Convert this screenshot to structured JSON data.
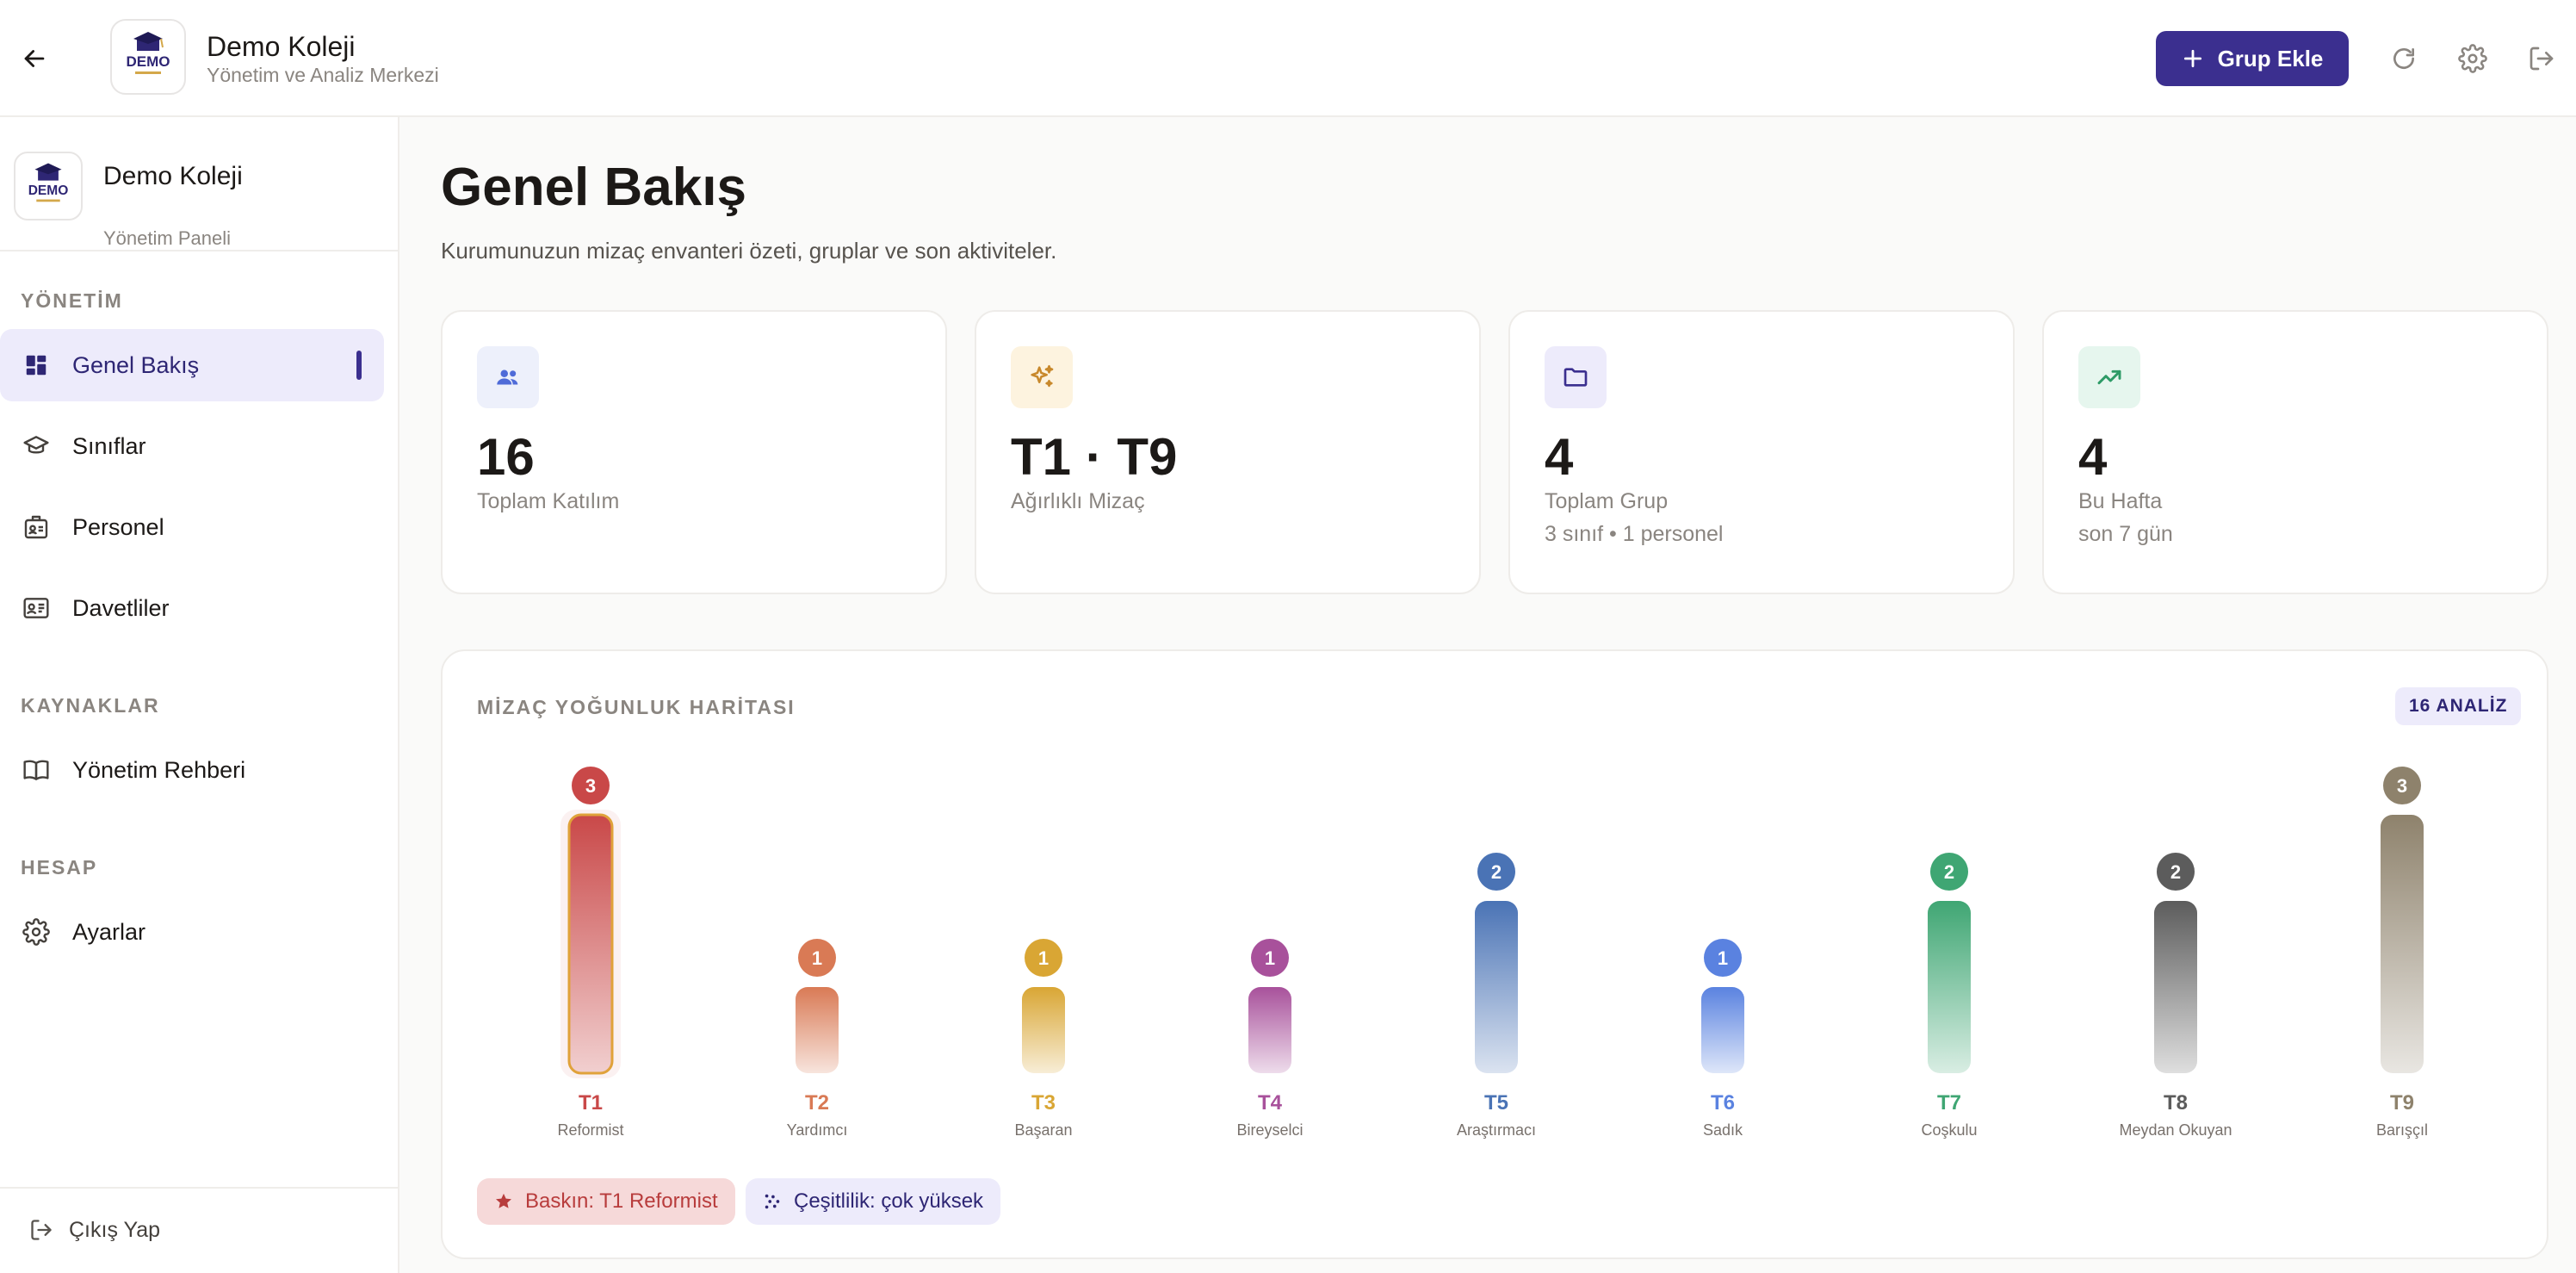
{
  "header": {
    "title": "Demo Koleji",
    "subtitle": "Yönetim ve Analiz Merkezi",
    "logo_text": "DEMO",
    "add_group_label": "Grup Ekle"
  },
  "sidebar": {
    "brand_title": "Demo Koleji",
    "brand_subtitle": "Yönetim Paneli",
    "sections": [
      {
        "label": "YÖNETİM"
      },
      {
        "label": "KAYNAKLAR"
      },
      {
        "label": "HESAP"
      }
    ],
    "items": [
      {
        "label": "Genel Bakış",
        "icon": "dashboard-icon",
        "active": true
      },
      {
        "label": "Sınıflar",
        "icon": "graduation-cap-icon"
      },
      {
        "label": "Personel",
        "icon": "id-badge-icon"
      },
      {
        "label": "Davetliler",
        "icon": "contact-card-icon"
      },
      {
        "label": "Yönetim Rehberi",
        "icon": "book-icon"
      },
      {
        "label": "Ayarlar",
        "icon": "gear-icon"
      }
    ],
    "logout_label": "Çıkış Yap"
  },
  "main": {
    "title": "Genel Bakış",
    "description": "Kurumunuzun mizaç envanteri özeti, gruplar ve son aktiviteler."
  },
  "stats": [
    {
      "value": "16",
      "label": "Toplam Katılım",
      "sub": "",
      "icon": "users-icon",
      "color": "#4f6bd8",
      "bg": "#edf0fb"
    },
    {
      "value": "T1 · T9",
      "label": "Ağırlıklı Mizaç",
      "sub": "",
      "icon": "sparkles-icon",
      "color": "#c8882b",
      "bg": "#fdf3df"
    },
    {
      "value": "4",
      "label": "Toplam Grup",
      "sub": "3 sınıf • 1 personel",
      "icon": "folder-icon",
      "color": "#3b2f8f",
      "bg": "#edebfb"
    },
    {
      "value": "4",
      "label": "Bu Hafta",
      "sub": "son 7 gün",
      "icon": "trending-up-icon",
      "color": "#2e9b67",
      "bg": "#e6f6ee"
    }
  ],
  "chart": {
    "title": "MİZAÇ YOĞUNLUK HARİTASI",
    "badge": "16 ANALİZ",
    "dominant_label": "Baskın: T1 Reformist",
    "diversity_label": "Çeşitlilik: çok yüksek"
  },
  "chart_data": {
    "type": "bar",
    "categories": [
      "T1",
      "T2",
      "T3",
      "T4",
      "T5",
      "T6",
      "T7",
      "T8",
      "T9"
    ],
    "subtitles": [
      "Reformist",
      "Yardımcı",
      "Başaran",
      "Bireyselci",
      "Araştırmacı",
      "Sadık",
      "Coşkulu",
      "Meydan Okuyan",
      "Barışçıl"
    ],
    "values": [
      3,
      1,
      1,
      1,
      2,
      1,
      2,
      2,
      3
    ],
    "colors": [
      "#c94848",
      "#d97a55",
      "#d9a634",
      "#a8519b",
      "#4a73b5",
      "#5a82e0",
      "#3fa673",
      "#5c5c5c",
      "#8e826c"
    ],
    "highlighted": "T1",
    "ylim": [
      0,
      3
    ]
  }
}
